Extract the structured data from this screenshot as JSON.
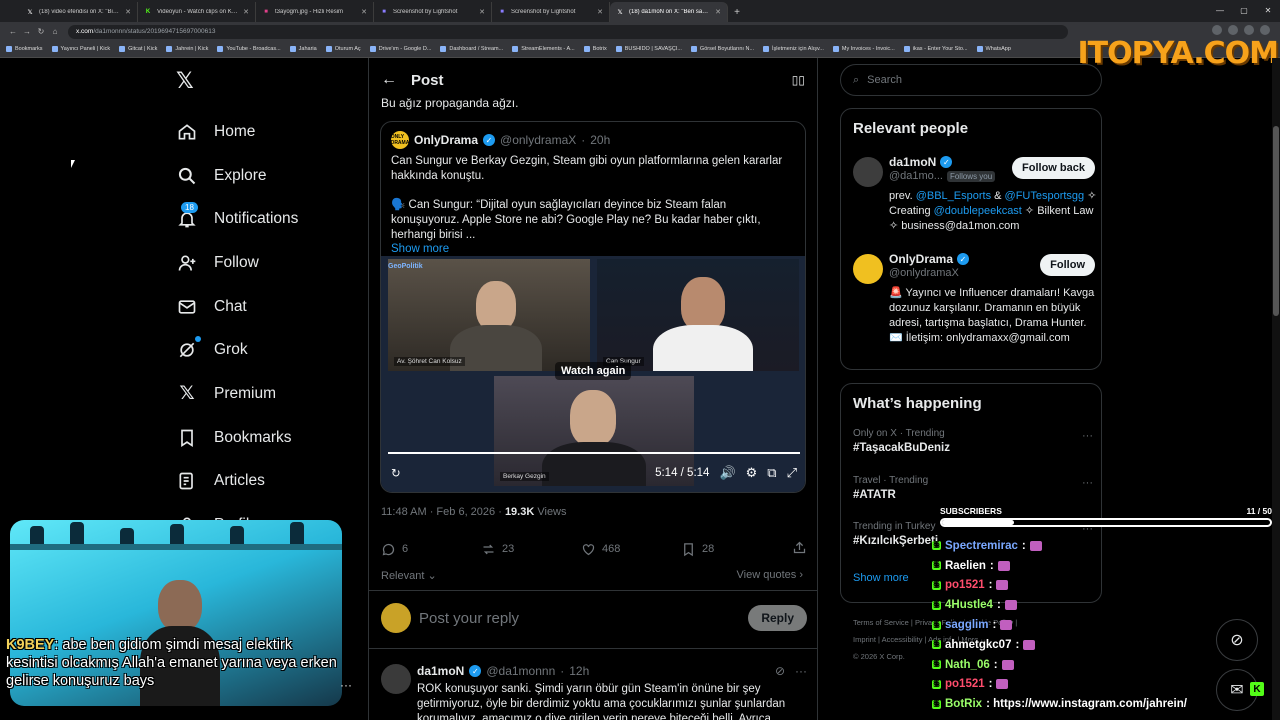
{
  "browser": {
    "tabs": [
      {
        "title": "(18) video efendisi on X: \"Bilal K...",
        "icon": "x",
        "color": "#ffffff"
      },
      {
        "title": "Videoyun - Watch clips on Kick",
        "icon": "kick",
        "color": "#53fc18"
      },
      {
        "title": "t3ayogm.jpg - Hizli Resim",
        "icon": "image",
        "color": "#e0408a"
      },
      {
        "title": "Screenshot by Lightshot",
        "icon": "lightshot",
        "color": "#8a7cff"
      },
      {
        "title": "Screenshot by Lightshot",
        "icon": "lightshot",
        "color": "#8a7cff"
      },
      {
        "title": "(18) da1moN on X: \"Ben sağına...",
        "icon": "x",
        "color": "#ffffff"
      }
    ],
    "active_tab": 5,
    "url_host": "x.com",
    "url_path": "/da1monnn/status/2019694715697000613",
    "bookmarks": [
      "Bookmarks",
      "Yayıncı Paneli | Kick",
      "Gitcat | Kick",
      "Jahrein | Kick",
      "YouTube - Broadcas...",
      "Jaharia",
      "Oturum Aç",
      "Drive'ım - Google D...",
      "Dashboard / Stream...",
      "StreamElements - A...",
      "Botrix",
      "BUSHIDO | SAVAŞÇI...",
      "Görsel Boyutlarını N...",
      "İşletmeniz için Alışv...",
      "My Invoices - Invoic...",
      "ikas - Enter Your Sto...",
      "WhatsApp"
    ],
    "sponsor": "ITOPYA.COM"
  },
  "nav": {
    "items": [
      {
        "label": "Home",
        "icon": "home-icon"
      },
      {
        "label": "Explore",
        "icon": "search-icon"
      },
      {
        "label": "Notifications",
        "icon": "bell-icon",
        "badge": "18"
      },
      {
        "label": "Follow",
        "icon": "follow-icon"
      },
      {
        "label": "Chat",
        "icon": "mail-icon"
      },
      {
        "label": "Grok",
        "icon": "grok-icon"
      },
      {
        "label": "Premium",
        "icon": "x-icon"
      },
      {
        "label": "Bookmarks",
        "icon": "bookmark-icon"
      },
      {
        "label": "Articles",
        "icon": "article-icon"
      },
      {
        "label": "Profile",
        "icon": "profile-icon"
      }
    ]
  },
  "post": {
    "header_title": "Post",
    "partial_text": "Bu ağız propaganda ağzı.",
    "quote": {
      "name": "OnlyDrama",
      "handle": "@onlydramaX",
      "time": "20h",
      "avatar_text": "ONLY DRAMA",
      "text1": "Can Sungur ve Berkay Gezgin, Steam gibi oyun platformlarına gelen kararlar hakkında konuştu.",
      "text2": "🗣️ Can Sungur: “Dijital oyun sağlayıcıları deyince biz Steam falan konuşuyoruz. Apple Store ne abi? Google Play ne? Bu kadar haber çıktı, herhangi birisi ...",
      "show_more": "Show more",
      "video": {
        "watch_again": "Watch again",
        "time": "5:14 / 5:14",
        "panel1_label": "Av. Şöhret Can Kolsuz",
        "panel2_label": "Can Sungur",
        "panel3_label": "Berkay Gezgin",
        "brand": "GeoPolitik",
        "progress": 1.0
      }
    },
    "timestamp": "11:48 AM · Feb 6, 2026 ·",
    "views": "19.3K",
    "views_label": "Views",
    "replies": "6",
    "reposts": "23",
    "likes": "468",
    "bookmarks": "28",
    "sort_label": "Relevant",
    "view_quotes": "View quotes",
    "reply_placeholder": "Post your reply",
    "reply_button": "Reply",
    "reply_tweet": {
      "name": "da1moN",
      "handle": "@da1monnn",
      "time": "12h",
      "text": "ROK konuşuyor sanki. Şimdi yarın öbür gün Steam'in önüne bir şey getirmiyoruz, öyle bir derdimiz yoktu ama çocuklarımızı şunlar şunlardan korumalıyız, amacımız o diye girilen yerin nereye biteceği belli. Ayrıca"
    }
  },
  "sidebar": {
    "search_placeholder": "Search",
    "relevant_title": "Relevant people",
    "people": [
      {
        "name": "da1moN",
        "handle": "@da1mo...",
        "follows_you": "Follows you",
        "button": "Follow back",
        "bio_parts": [
          {
            "t": "prev. ",
            "link": false
          },
          {
            "t": "@BBL_Esports",
            "link": true
          },
          {
            "t": " & ",
            "link": false
          },
          {
            "t": "@FUTesportsgg",
            "link": true
          },
          {
            "t": " ✧ Creating ",
            "link": false
          },
          {
            "t": "@doublepeekcast",
            "link": true
          },
          {
            "t": " ✧ Bilkent Law ✧ business@da1mon.com",
            "link": false
          }
        ]
      },
      {
        "name": "OnlyDrama",
        "handle": "@onlydramaX",
        "button": "Follow",
        "bio_parts": [
          {
            "t": "🚨 Yayıncı ve Influencer dramaları! Kavga dozunuz karşılanır. Dramanın en büyük adresi, tartışma başlatıcı, Drama Hunter. ✉️ İletişim: onlydramaxx@gmail.com",
            "link": false
          }
        ]
      }
    ],
    "happening_title": "What’s happening",
    "trends": [
      {
        "category": "Only on X · Trending",
        "name": "#TaşacakBuDeniz"
      },
      {
        "category": "Travel · Trending",
        "name": "#ATATR"
      },
      {
        "category": "Trending in Turkey",
        "name": "#KızılcıkŞerbeti"
      }
    ],
    "show_more": "Show more",
    "footer_line1": "Terms of Service  |  Privacy Policy  |  Cookie Policy  |",
    "footer_line2": "Imprint  |  Accessibility  |  Ads info  |  More ···",
    "footer_line3": "© 2026 X Corp."
  },
  "stream": {
    "caption_user": "K9BEY",
    "caption_text": ": abe ben gidiom şimdi mesaj elektirk kesintisi olcakmış Allah'a emanet yarına veya erken gelirse konuşuruz bays",
    "subs_label": "SUBSCRIBERS",
    "subs_current": "11",
    "subs_goal": "50",
    "subs_fraction": 0.22,
    "chat": [
      {
        "user": "Spectremirac",
        "color": "#7aa8ff",
        "msg": ":"
      },
      {
        "user": "Raelien",
        "color": "#ffffff",
        "msg": ":"
      },
      {
        "user": "po1521",
        "color": "#ff4d6d",
        "msg": ":"
      },
      {
        "user": "4Hustle4",
        "color": "#9bff6a",
        "msg": ":"
      },
      {
        "user": "sagglim",
        "color": "#7aa8ff",
        "msg": ":"
      },
      {
        "user": "ahmetgkc07",
        "color": "#ffffff",
        "msg": ":"
      },
      {
        "user": "Nath_06",
        "color": "#9bff6a",
        "msg": ":"
      },
      {
        "user": "po1521",
        "color": "#ff4d6d",
        "msg": ":"
      },
      {
        "user": "BotRix",
        "color": "#9bff6a",
        "msg": ": https://www.instagram.com/jahrein/"
      }
    ]
  },
  "colors": {
    "accent": "#1d9bf0",
    "background": "#000000",
    "kick_green": "#53fc18"
  }
}
